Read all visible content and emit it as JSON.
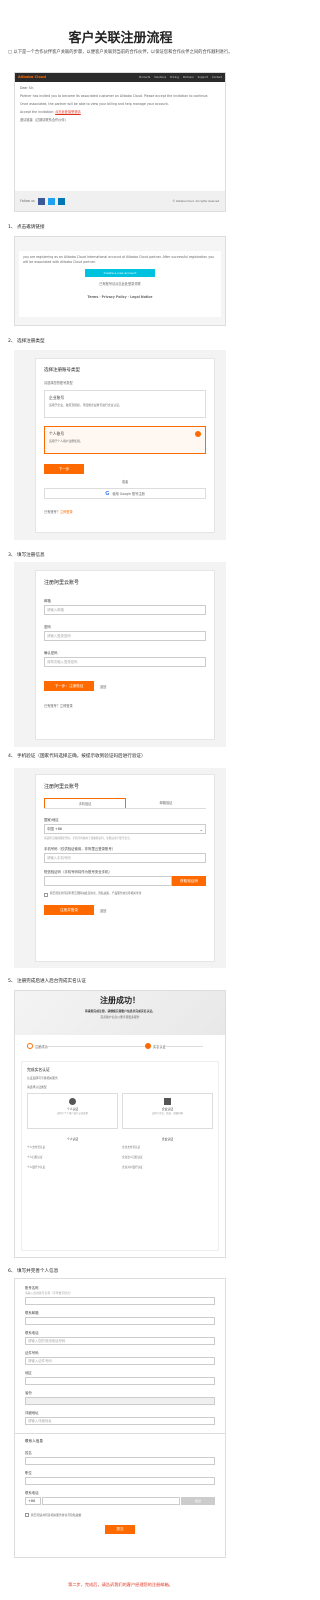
{
  "page": {
    "title": "客户关联注册流程",
    "intro": "□ 以下是一个合作伙伴客户关联的步骤，以便客户关联到当前的合作伙伴，以保证您和合作伙伴之间的合作顺利进行。"
  },
  "steps": {
    "s1": "1、 点击邀请链接",
    "s2": "2、 选择注册类型",
    "s3": "3、 填写注册信息",
    "s4": "4、 手机验证（国家代码选择正确，按提示收到验证码后进行验证）",
    "s5": "5、 注册完成后进入后台完成实名认证",
    "s6": "6、 填写并完善个人信息"
  },
  "email": {
    "brand": "Alibaba Cloud",
    "nav": [
      "Products",
      "Solutions",
      "Pricing",
      "Partners",
      "Support",
      "Contact"
    ],
    "greeting": "Dear Sir,",
    "body1": "Partner has invited you to become its associated customer on Alibaba Cloud. Please accept the invitation to continue.",
    "body2": "Once associated, the partner will be able to view your billing and help manage your account.",
    "link_label": "Accept the invitation:",
    "link_text": "点击此处接受邀请",
    "link_text2": "邀请链接（过期请联系合作伙伴）",
    "footer_brand": "Follow us",
    "footer_note": "© Alibaba Cloud. All rights reserved."
  },
  "invite": {
    "text": "you are registering as an Alibaba Cloud International account of Alibaba Cloud partner. After successful registration you will be associated with Alibaba Cloud partner.",
    "button": "Create a new account",
    "note": "已有账号请点击此处登录关联",
    "links": "Terms  ·  Privacy Policy  ·  Legal Notice"
  },
  "register_type": {
    "title": "选择注册账号类型",
    "subtitle": "请选择您的账号类型",
    "opt1_title": "企业账号",
    "opt1_desc": "适用于企业、政府及组织，可使用企业账号进行企业认证。",
    "opt2_title": "个人账号",
    "opt2_desc": "适用于个人用户注册使用。",
    "next": "下一步",
    "or": "或者",
    "google": "使用 Google 账号注册",
    "login": "已有账号？",
    "login_link": "立即登录"
  },
  "form": {
    "title": "注册阿里云账号",
    "email_label": "邮箱",
    "email_ph": "请输入邮箱",
    "pwd_label": "密码",
    "pwd_ph": "请输入登录密码",
    "pwd2_label": "确认密码",
    "pwd2_ph": "请再次输入登录密码",
    "submit": "下一步：注册验证",
    "back": "返回",
    "foot": "已有账号？立即登录"
  },
  "verify": {
    "title": "注册阿里云账号",
    "tab1": "手机验证",
    "tab2": "邮箱验证",
    "country_label": "国家/地区",
    "country_value": "中国 +86",
    "country_note": "请选择正确的国家代码，手机号码将用于接收验证码，注册后用于账号安全。",
    "phone_label": "手机号码（仅供验证使用，非阿里云登录账号）",
    "phone_ph": "请输入手机号码",
    "code_label": "短信验证码（手机号码将作为账号安全手机）",
    "code_ph": "",
    "code_btn": "获取验证码",
    "agree": "我已阅读并同意阿里云国际站会员协议、隐私政策、产品服务协议等相关条款",
    "submit": "注册并登录",
    "back": "返回"
  },
  "success": {
    "title": "注册成功！",
    "sub1": "恭喜您完成注册，请继续完善账户信息并完成实名认证。",
    "sub2": "完善账户信息以便享受更多服务",
    "step1": "注册成功",
    "step2": "实名认证",
    "card_title": "完成实名认证",
    "card_sub": "认证后即可享受相关服务",
    "type_label": "请选择认证类型",
    "opt_a": "个人认证",
    "opt_a_desc": "适用于个人用户进行认证使用",
    "opt_b": "企业认证",
    "opt_b_desc": "适用于企业、政府、组织机构",
    "col1_title": "个人认证",
    "col1_lines": [
      "个人支付宝认证",
      "个人扫脸认证",
      "个人银行卡认证"
    ],
    "col2_title": "企业认证",
    "col2_lines": [
      "企业支付宝认证",
      "企业法人扫脸认证",
      "企业对公银行认证"
    ]
  },
  "info": {
    "s1_label": "账号名称",
    "s1_value": "请输入您的账号名称（字母数字组合）",
    "s2_label": "联系邮箱",
    "s3_label": "联系电话",
    "s3_value": "请输入您的常用电话号码",
    "s4_label": "证件号码",
    "s4_value": "请输入证件号码",
    "s5_label": "地区",
    "s6_label": "省份",
    "s7_label": "详细地址",
    "s7_value": "请输入详细地址",
    "b_title": "联系人信息",
    "b1_label": "姓名",
    "b2_label": "职位",
    "b3_label": "联系电话",
    "b3_prefix": "+86",
    "b3_btn": "验证",
    "agree": "我已阅读并同意相关服务协议与隐私政策",
    "submit": "提交"
  },
  "footer": {
    "note": "第二步，完成后，请告诉我们的客户经理您的注册邮箱。"
  },
  "colors": {
    "accent": "#ff6a00",
    "red": "#e0301e",
    "email_header": "#2b2b2b"
  }
}
